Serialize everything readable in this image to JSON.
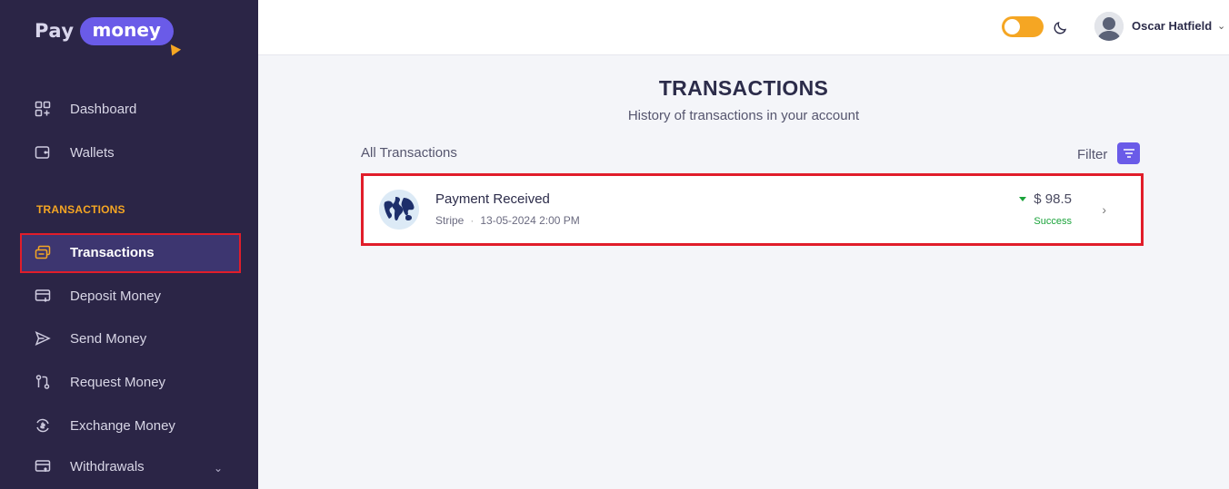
{
  "brand": {
    "part1": "Pay",
    "part2": "money"
  },
  "sidebar": {
    "items": [
      {
        "label": "Dashboard",
        "icon": "dashboard-icon"
      },
      {
        "label": "Wallets",
        "icon": "wallet-icon"
      }
    ],
    "section_label": "TRANSACTIONS",
    "section_items": [
      {
        "label": "Transactions",
        "icon": "transactions-icon",
        "active": true
      },
      {
        "label": "Deposit Money",
        "icon": "deposit-icon"
      },
      {
        "label": "Send Money",
        "icon": "send-icon"
      },
      {
        "label": "Request Money",
        "icon": "request-icon"
      },
      {
        "label": "Exchange Money",
        "icon": "exchange-icon"
      },
      {
        "label": "Withdrawals",
        "icon": "withdraw-icon",
        "expandable": true
      }
    ]
  },
  "header": {
    "user_name": "Oscar Hatfield",
    "theme_toggle": "light"
  },
  "main": {
    "title": "TRANSACTIONS",
    "subtitle": "History of transactions in your account",
    "list_label": "All Transactions",
    "filter_label": "Filter",
    "transactions": [
      {
        "title": "Payment Received",
        "method": "Stripe",
        "datetime": "13-05-2024 2:00 PM",
        "amount": "$ 98.5",
        "status": "Success"
      }
    ]
  },
  "colors": {
    "sidebar_bg": "#2b2546",
    "accent": "#6a5be8",
    "orange": "#f5a623",
    "success": "#1aa33a",
    "highlight": "#e11d2a"
  }
}
